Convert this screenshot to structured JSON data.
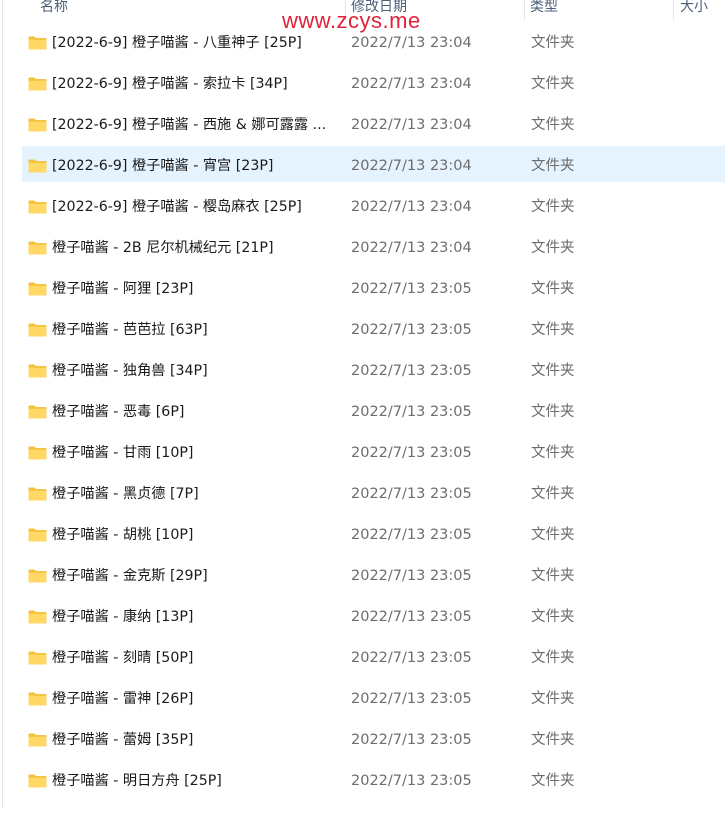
{
  "header": {
    "name": "名称",
    "date": "修改日期",
    "type": "类型",
    "size": "大小"
  },
  "watermark": "www.zcys.me",
  "selected_index": 3,
  "colors": {
    "selection": "#e5f3ff",
    "watermark": "#e0233b",
    "folder_back": "#f3c23f",
    "folder_front": "#ffd865"
  },
  "files": [
    {
      "name": "[2022-6-9] 橙子喵酱 - 八重神子 [25P]",
      "date": "2022/7/13 23:04",
      "type": "文件夹",
      "icon": "folder-icon"
    },
    {
      "name": "[2022-6-9] 橙子喵酱 - 索拉卡 [34P]",
      "date": "2022/7/13 23:04",
      "type": "文件夹",
      "icon": "folder-icon"
    },
    {
      "name": "[2022-6-9] 橙子喵酱 - 西施 & 娜可露露 ...",
      "date": "2022/7/13 23:04",
      "type": "文件夹",
      "icon": "folder-icon"
    },
    {
      "name": "[2022-6-9] 橙子喵酱 - 宵宫 [23P]",
      "date": "2022/7/13 23:04",
      "type": "文件夹",
      "icon": "folder-icon"
    },
    {
      "name": "[2022-6-9] 橙子喵酱 - 樱岛麻衣 [25P]",
      "date": "2022/7/13 23:04",
      "type": "文件夹",
      "icon": "folder-icon"
    },
    {
      "name": "橙子喵酱 - 2B 尼尔机械纪元 [21P]",
      "date": "2022/7/13 23:04",
      "type": "文件夹",
      "icon": "folder-icon"
    },
    {
      "name": "橙子喵酱 - 阿狸 [23P]",
      "date": "2022/7/13 23:05",
      "type": "文件夹",
      "icon": "folder-icon"
    },
    {
      "name": "橙子喵酱 - 芭芭拉 [63P]",
      "date": "2022/7/13 23:05",
      "type": "文件夹",
      "icon": "folder-icon"
    },
    {
      "name": "橙子喵酱 - 独角兽 [34P]",
      "date": "2022/7/13 23:05",
      "type": "文件夹",
      "icon": "folder-icon"
    },
    {
      "name": "橙子喵酱 - 恶毒 [6P]",
      "date": "2022/7/13 23:05",
      "type": "文件夹",
      "icon": "folder-icon"
    },
    {
      "name": "橙子喵酱 - 甘雨 [10P]",
      "date": "2022/7/13 23:05",
      "type": "文件夹",
      "icon": "folder-icon"
    },
    {
      "name": "橙子喵酱 - 黑贞德 [7P]",
      "date": "2022/7/13 23:05",
      "type": "文件夹",
      "icon": "folder-icon"
    },
    {
      "name": "橙子喵酱 - 胡桃 [10P]",
      "date": "2022/7/13 23:05",
      "type": "文件夹",
      "icon": "folder-icon"
    },
    {
      "name": "橙子喵酱 - 金克斯 [29P]",
      "date": "2022/7/13 23:05",
      "type": "文件夹",
      "icon": "folder-icon"
    },
    {
      "name": "橙子喵酱 - 康纳 [13P]",
      "date": "2022/7/13 23:05",
      "type": "文件夹",
      "icon": "folder-icon"
    },
    {
      "name": "橙子喵酱 - 刻晴 [50P]",
      "date": "2022/7/13 23:05",
      "type": "文件夹",
      "icon": "folder-icon"
    },
    {
      "name": "橙子喵酱 - 雷神 [26P]",
      "date": "2022/7/13 23:05",
      "type": "文件夹",
      "icon": "folder-icon"
    },
    {
      "name": "橙子喵酱 - 蕾姆 [35P]",
      "date": "2022/7/13 23:05",
      "type": "文件夹",
      "icon": "folder-icon"
    },
    {
      "name": "橙子喵酱 - 明日方舟 [25P]",
      "date": "2022/7/13 23:05",
      "type": "文件夹",
      "icon": "folder-icon"
    }
  ]
}
